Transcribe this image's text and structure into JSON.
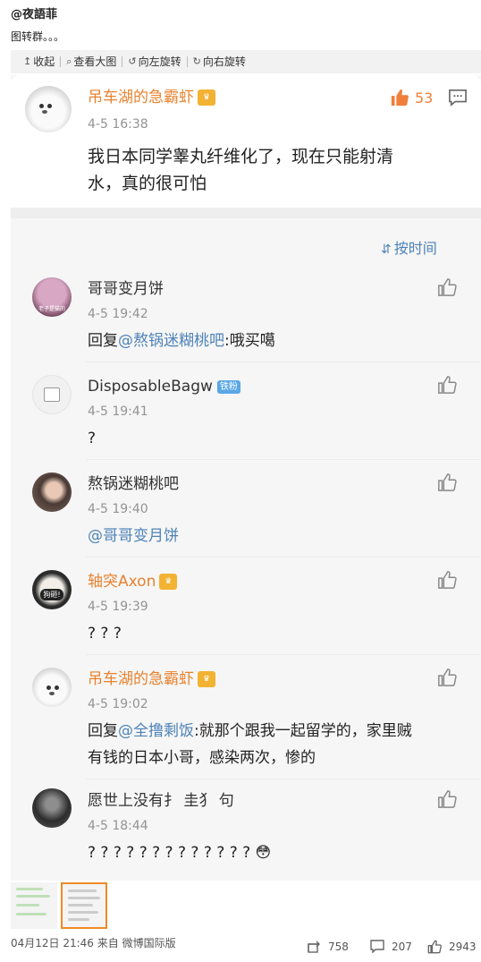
{
  "header": {
    "author": "@夜語菲",
    "caption": "图转群。。。"
  },
  "toolbar": [
    {
      "icon": "↥",
      "label": "收起"
    },
    {
      "icon": "⌕",
      "label": "查看大图"
    },
    {
      "icon": "↺",
      "label": "向左旋转"
    },
    {
      "icon": "↻",
      "label": "向右旋转"
    }
  ],
  "main_comment": {
    "name": "吊车湖的急霸虾",
    "time": "4-5 16:38",
    "likes": "53",
    "text_line1": "我日本同学睾丸纤维化了，现在只能射清",
    "text_line2": "水，真的很可怕"
  },
  "sort_label": "按时间",
  "replies": [
    {
      "name": "哥哥变月饼",
      "time": "4-5 19:42",
      "prefix": "回复",
      "mention": "@熬锅迷糊桃吧",
      "text": ":哦买噶",
      "avatar_label": "老子是猫的"
    },
    {
      "name": "DisposableBagw",
      "badge": "铁粉",
      "time": "4-5 19:41",
      "text": "?"
    },
    {
      "name": "熬锅迷糊桃吧",
      "time": "4-5 19:40",
      "mention": "@哥哥变月饼"
    },
    {
      "name": "轴突Axon",
      "time": "4-5 19:39",
      "text": "? ? ?",
      "avatar_label": "狗砸!"
    },
    {
      "name": "吊车湖的急霸虾",
      "time": "4-5 19:02",
      "prefix": "回复",
      "mention": "@全撸剩饭",
      "text": ":就那个跟我一起留学的，家里贼",
      "text2": "有钱的日本小哥，感染两次，惨的"
    },
    {
      "name": "愿世上没有扌 圭犭 句",
      "time": "4-5 18:44",
      "text": "? ? ? ? ? ? ? ? ? ? ? ? ? 😳"
    }
  ],
  "footer": {
    "source": "04月12日 21:46 来自 微博国际版",
    "reposts": "758",
    "comments": "207",
    "likes": "2943"
  },
  "colors": {
    "vip_name": "#e8822e",
    "mention": "#4e83b8",
    "like_orange": "#ef7f3a"
  }
}
